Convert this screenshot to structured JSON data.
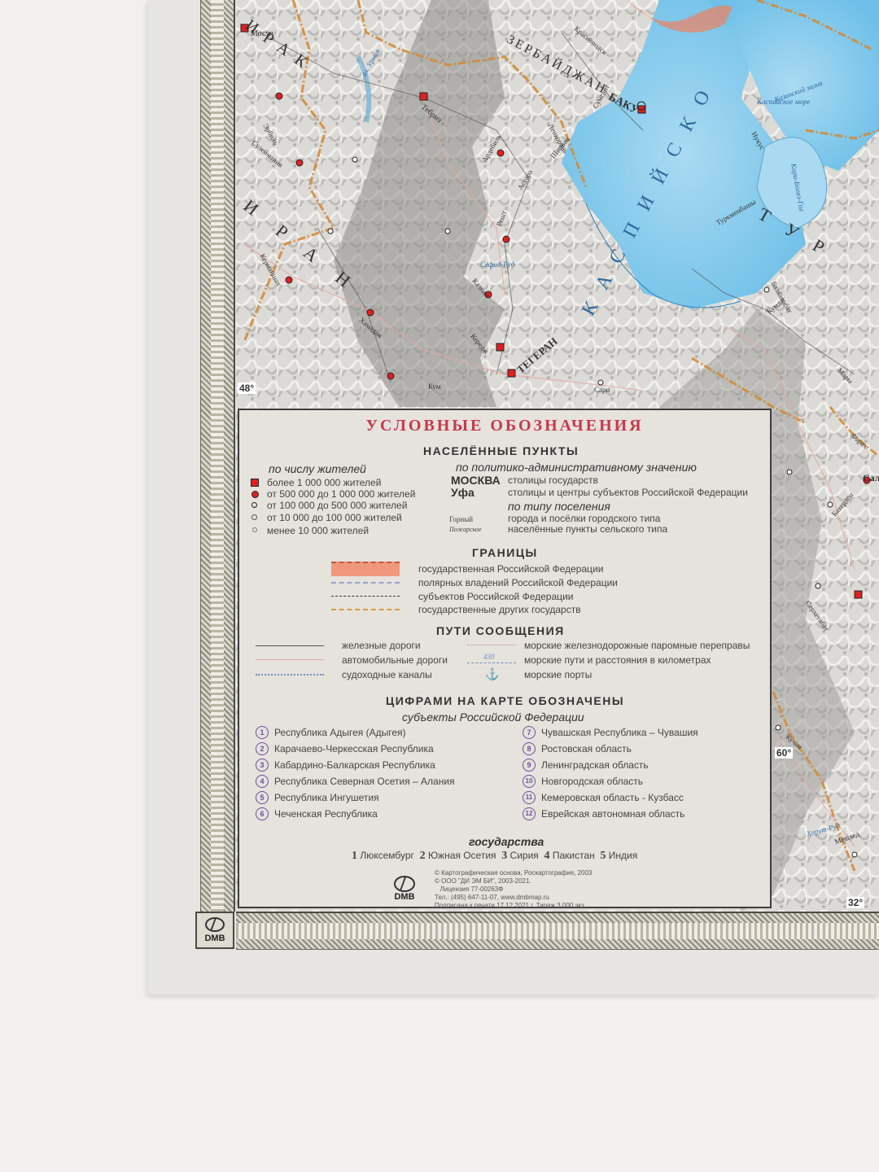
{
  "legend": {
    "title": "УСЛОВНЫЕ ОБОЗНАЧЕНИЯ",
    "settlements": {
      "heading": "НАСЕЛЁННЫЕ ПУНКТЫ",
      "by_population_heading": "по числу жителей",
      "by_population": [
        "более 1 000 000 жителей",
        "от 500 000 до 1 000 000 жителей",
        "от 100 000 до 500 000 жителей",
        "от 10 000 до 100 000 жителей",
        "менее 10 000 жителей"
      ],
      "by_admin_heading": "по политико-административному значению",
      "admin_examples": [
        {
          "sample": "МОСКВА",
          "text": "столицы государств"
        },
        {
          "sample": "Уфа",
          "text": "столицы и центры субъектов Российской Федерации"
        }
      ],
      "by_type_heading": "по типу поселения",
      "type_examples": [
        {
          "sample": "Горный",
          "text": "города и посёлки городского типа"
        },
        {
          "sample": "Пожарское",
          "text": "населённые пункты сельского типа"
        }
      ]
    },
    "borders": {
      "heading": "ГРАНИЦЫ",
      "items": [
        "государственная Российской Федерации",
        "полярных владений Российской Федерации",
        "субъектов Российской Федерации",
        "государственные других государств"
      ]
    },
    "routes": {
      "heading": "ПУТИ СООБЩЕНИЯ",
      "left": [
        "железные дороги",
        "автомобильные дороги",
        "судоходные каналы"
      ],
      "right": [
        "морские железнодорожные паромные переправы",
        "морские пути  и расстояния в километрах",
        "морские порты"
      ],
      "distance_sample": "430"
    },
    "numbers": {
      "heading": "ЦИФРАМИ НА КАРТЕ ОБОЗНАЧЕНЫ",
      "subheading": "субъекты Российской Федерации",
      "left": [
        {
          "n": "1",
          "text": "Республика Адыгея (Адыгея)"
        },
        {
          "n": "2",
          "text": "Карачаево-Черкесская Республика"
        },
        {
          "n": "3",
          "text": "Кабардино-Балкарская Республика"
        },
        {
          "n": "4",
          "text": "Республика Северная Осетия – Алания"
        },
        {
          "n": "5",
          "text": "Республика Ингушетия"
        },
        {
          "n": "6",
          "text": "Чеченская Республика"
        }
      ],
      "right": [
        {
          "n": "7",
          "text": "Чувашская Республика – Чувашия"
        },
        {
          "n": "8",
          "text": "Ростовская область"
        },
        {
          "n": "9",
          "text": "Ленинградская область"
        },
        {
          "n": "10",
          "text": "Новгородская область"
        },
        {
          "n": "11",
          "text": "Кемеровская область - Кузбасс"
        },
        {
          "n": "12",
          "text": "Еврейская автономная область"
        }
      ],
      "states_heading": "государства",
      "states": [
        {
          "n": "1",
          "name": "Люксембург"
        },
        {
          "n": "2",
          "name": "Южная Осетия"
        },
        {
          "n": "3",
          "name": "Сирия"
        },
        {
          "n": "4",
          "name": "Пакистан"
        },
        {
          "n": "5",
          "name": "Индия"
        }
      ]
    },
    "copyright": [
      "© Картографическая основа, Роскартография, 2003",
      "© ООО \"ДИ ЭМ БИ\", 2003-2021.",
      "   Лицензия 77-00263Ф",
      "Тел.: (495) 647-11-07, www.dmbmap.ru",
      "Подписана к печати 17.12.2021 г. Тираж 3 000 экз."
    ],
    "logo_text": "DMB"
  },
  "frame": {
    "logo_text": "DMB"
  },
  "map": {
    "degree_labels": [
      "48°",
      "60°",
      "32°"
    ],
    "labels": {
      "iran": [
        "И",
        "Р",
        "А",
        "Н"
      ],
      "iraq": [
        "И",
        "Р",
        "А",
        "К"
      ],
      "caspian": [
        "К",
        "А",
        "С",
        "П",
        "И",
        "Й",
        "С",
        "К",
        "О"
      ],
      "turkmen": [
        "Т",
        "У",
        "Р"
      ],
      "azerbaijan": "ЗЕРБАЙДЖАН",
      "baku": "БАКУ",
      "tehran": "ТЕГЕРАН",
      "cities": [
        "Мосул",
        "Эрбиль",
        "Сулеймания",
        "Тебриз",
        "Ардебиль",
        "Астара",
        "Решт",
        "Казвин",
        "Кередж",
        "Хамадан",
        "Керманшах",
        "Кум",
        "Сари",
        "Туркменбашы",
        "Балканабат",
        "Кумдаг",
        "Серхетабат",
        "Мары",
        "Нукус",
        "Красноводск",
        "Сумгаит",
        "Ширван",
        "Ленкорань",
        "Сальяны",
        "Мешхед",
        "Фарах",
        "Бахерден",
        "Кучан"
      ],
      "water": [
        "Каспийское море",
        "Кара-Богаз-Гол",
        "Казахский залив",
        "оз. Урмия",
        "Сефид-Руд",
        "Харут-Руд"
      ]
    }
  }
}
